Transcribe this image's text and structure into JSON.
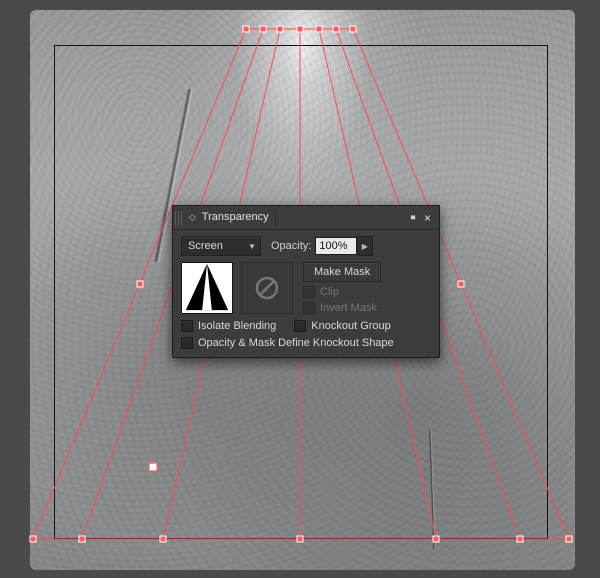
{
  "panel": {
    "title": "Transparency",
    "blendMode": "Screen",
    "opacityLabel": "Opacity:",
    "opacityValue": "100%",
    "makeMaskLabel": "Make Mask",
    "clipLabel": "Clip",
    "invertMaskLabel": "Invert Mask",
    "isolateBlendingLabel": "Isolate Blending",
    "knockoutGroupLabel": "Knockout Group",
    "opacityMaskKnockoutLabel": "Opacity & Mask Define Knockout Shape",
    "clipEnabled": false,
    "invertEnabled": false
  },
  "icons": {
    "panelMenu": "◂▸",
    "close": "×",
    "dropdownArrow": "▼",
    "stepperArrow": "▶"
  }
}
